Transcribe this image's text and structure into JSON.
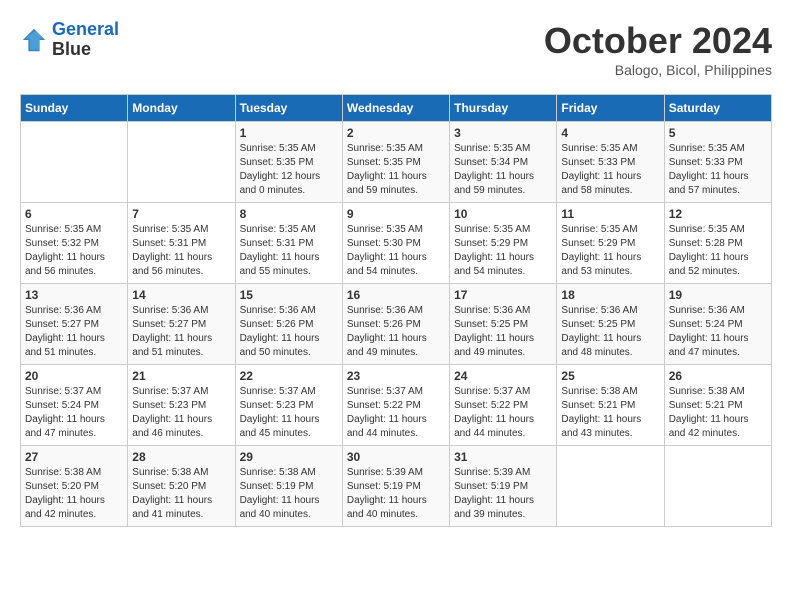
{
  "logo": {
    "line1": "General",
    "line2": "Blue"
  },
  "title": "October 2024",
  "location": "Balogo, Bicol, Philippines",
  "headers": [
    "Sunday",
    "Monday",
    "Tuesday",
    "Wednesday",
    "Thursday",
    "Friday",
    "Saturday"
  ],
  "weeks": [
    [
      {
        "day": "",
        "sunrise": "",
        "sunset": "",
        "daylight": ""
      },
      {
        "day": "",
        "sunrise": "",
        "sunset": "",
        "daylight": ""
      },
      {
        "day": "1",
        "sunrise": "Sunrise: 5:35 AM",
        "sunset": "Sunset: 5:35 PM",
        "daylight": "Daylight: 12 hours and 0 minutes."
      },
      {
        "day": "2",
        "sunrise": "Sunrise: 5:35 AM",
        "sunset": "Sunset: 5:35 PM",
        "daylight": "Daylight: 11 hours and 59 minutes."
      },
      {
        "day": "3",
        "sunrise": "Sunrise: 5:35 AM",
        "sunset": "Sunset: 5:34 PM",
        "daylight": "Daylight: 11 hours and 59 minutes."
      },
      {
        "day": "4",
        "sunrise": "Sunrise: 5:35 AM",
        "sunset": "Sunset: 5:33 PM",
        "daylight": "Daylight: 11 hours and 58 minutes."
      },
      {
        "day": "5",
        "sunrise": "Sunrise: 5:35 AM",
        "sunset": "Sunset: 5:33 PM",
        "daylight": "Daylight: 11 hours and 57 minutes."
      }
    ],
    [
      {
        "day": "6",
        "sunrise": "Sunrise: 5:35 AM",
        "sunset": "Sunset: 5:32 PM",
        "daylight": "Daylight: 11 hours and 56 minutes."
      },
      {
        "day": "7",
        "sunrise": "Sunrise: 5:35 AM",
        "sunset": "Sunset: 5:31 PM",
        "daylight": "Daylight: 11 hours and 56 minutes."
      },
      {
        "day": "8",
        "sunrise": "Sunrise: 5:35 AM",
        "sunset": "Sunset: 5:31 PM",
        "daylight": "Daylight: 11 hours and 55 minutes."
      },
      {
        "day": "9",
        "sunrise": "Sunrise: 5:35 AM",
        "sunset": "Sunset: 5:30 PM",
        "daylight": "Daylight: 11 hours and 54 minutes."
      },
      {
        "day": "10",
        "sunrise": "Sunrise: 5:35 AM",
        "sunset": "Sunset: 5:29 PM",
        "daylight": "Daylight: 11 hours and 54 minutes."
      },
      {
        "day": "11",
        "sunrise": "Sunrise: 5:35 AM",
        "sunset": "Sunset: 5:29 PM",
        "daylight": "Daylight: 11 hours and 53 minutes."
      },
      {
        "day": "12",
        "sunrise": "Sunrise: 5:35 AM",
        "sunset": "Sunset: 5:28 PM",
        "daylight": "Daylight: 11 hours and 52 minutes."
      }
    ],
    [
      {
        "day": "13",
        "sunrise": "Sunrise: 5:36 AM",
        "sunset": "Sunset: 5:27 PM",
        "daylight": "Daylight: 11 hours and 51 minutes."
      },
      {
        "day": "14",
        "sunrise": "Sunrise: 5:36 AM",
        "sunset": "Sunset: 5:27 PM",
        "daylight": "Daylight: 11 hours and 51 minutes."
      },
      {
        "day": "15",
        "sunrise": "Sunrise: 5:36 AM",
        "sunset": "Sunset: 5:26 PM",
        "daylight": "Daylight: 11 hours and 50 minutes."
      },
      {
        "day": "16",
        "sunrise": "Sunrise: 5:36 AM",
        "sunset": "Sunset: 5:26 PM",
        "daylight": "Daylight: 11 hours and 49 minutes."
      },
      {
        "day": "17",
        "sunrise": "Sunrise: 5:36 AM",
        "sunset": "Sunset: 5:25 PM",
        "daylight": "Daylight: 11 hours and 49 minutes."
      },
      {
        "day": "18",
        "sunrise": "Sunrise: 5:36 AM",
        "sunset": "Sunset: 5:25 PM",
        "daylight": "Daylight: 11 hours and 48 minutes."
      },
      {
        "day": "19",
        "sunrise": "Sunrise: 5:36 AM",
        "sunset": "Sunset: 5:24 PM",
        "daylight": "Daylight: 11 hours and 47 minutes."
      }
    ],
    [
      {
        "day": "20",
        "sunrise": "Sunrise: 5:37 AM",
        "sunset": "Sunset: 5:24 PM",
        "daylight": "Daylight: 11 hours and 47 minutes."
      },
      {
        "day": "21",
        "sunrise": "Sunrise: 5:37 AM",
        "sunset": "Sunset: 5:23 PM",
        "daylight": "Daylight: 11 hours and 46 minutes."
      },
      {
        "day": "22",
        "sunrise": "Sunrise: 5:37 AM",
        "sunset": "Sunset: 5:23 PM",
        "daylight": "Daylight: 11 hours and 45 minutes."
      },
      {
        "day": "23",
        "sunrise": "Sunrise: 5:37 AM",
        "sunset": "Sunset: 5:22 PM",
        "daylight": "Daylight: 11 hours and 44 minutes."
      },
      {
        "day": "24",
        "sunrise": "Sunrise: 5:37 AM",
        "sunset": "Sunset: 5:22 PM",
        "daylight": "Daylight: 11 hours and 44 minutes."
      },
      {
        "day": "25",
        "sunrise": "Sunrise: 5:38 AM",
        "sunset": "Sunset: 5:21 PM",
        "daylight": "Daylight: 11 hours and 43 minutes."
      },
      {
        "day": "26",
        "sunrise": "Sunrise: 5:38 AM",
        "sunset": "Sunset: 5:21 PM",
        "daylight": "Daylight: 11 hours and 42 minutes."
      }
    ],
    [
      {
        "day": "27",
        "sunrise": "Sunrise: 5:38 AM",
        "sunset": "Sunset: 5:20 PM",
        "daylight": "Daylight: 11 hours and 42 minutes."
      },
      {
        "day": "28",
        "sunrise": "Sunrise: 5:38 AM",
        "sunset": "Sunset: 5:20 PM",
        "daylight": "Daylight: 11 hours and 41 minutes."
      },
      {
        "day": "29",
        "sunrise": "Sunrise: 5:38 AM",
        "sunset": "Sunset: 5:19 PM",
        "daylight": "Daylight: 11 hours and 40 minutes."
      },
      {
        "day": "30",
        "sunrise": "Sunrise: 5:39 AM",
        "sunset": "Sunset: 5:19 PM",
        "daylight": "Daylight: 11 hours and 40 minutes."
      },
      {
        "day": "31",
        "sunrise": "Sunrise: 5:39 AM",
        "sunset": "Sunset: 5:19 PM",
        "daylight": "Daylight: 11 hours and 39 minutes."
      },
      {
        "day": "",
        "sunrise": "",
        "sunset": "",
        "daylight": ""
      },
      {
        "day": "",
        "sunrise": "",
        "sunset": "",
        "daylight": ""
      }
    ]
  ]
}
